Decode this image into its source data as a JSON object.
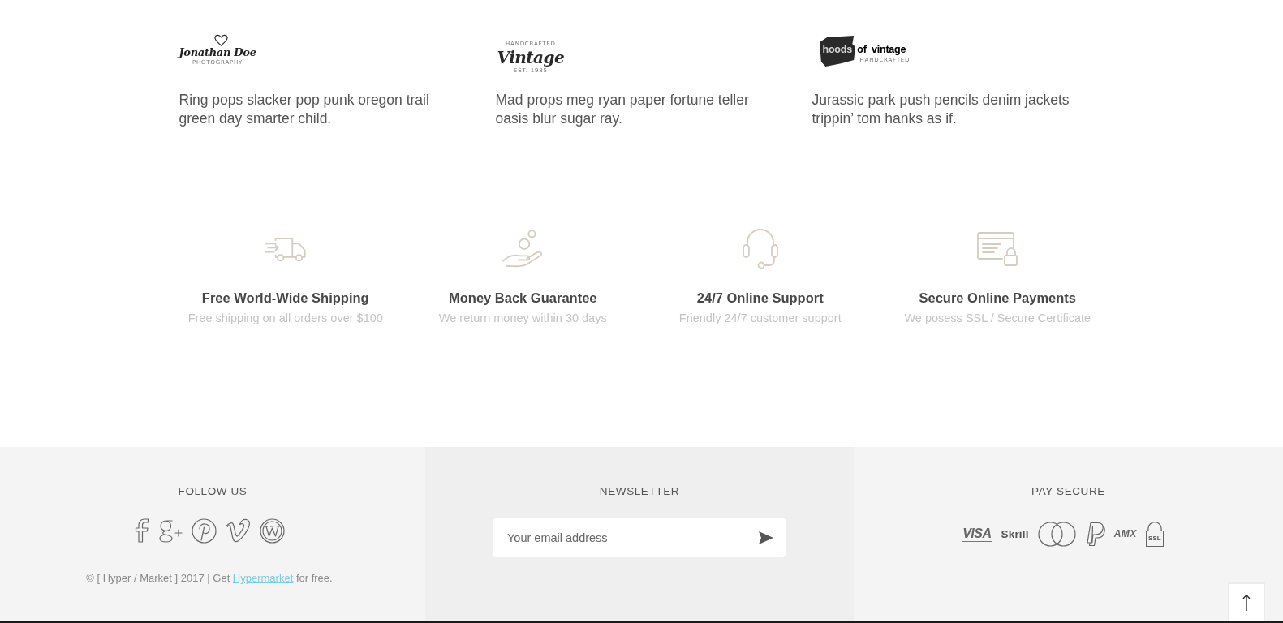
{
  "testimonials": [
    {
      "logo": {
        "kind": "heart",
        "name": "Jonathan Doe",
        "tagline": "PHOTOGRAPHY"
      },
      "text": "Ring pops slacker pop punk oregon trail green day smarter child."
    },
    {
      "logo": {
        "kind": "badge",
        "overline": "HANDCRAFTED",
        "name": "Vintage",
        "tagline": "EST. 1985"
      },
      "text": "Mad props meg ryan paper fortune teller oasis blur sugar ray."
    },
    {
      "logo": {
        "kind": "brush",
        "name": "hoods of vintage",
        "tagline": "HANDCRAFTED"
      },
      "text": "Jurassic park push pencils denim jackets trippin’ tom hanks as if."
    }
  ],
  "features": [
    {
      "kind": "shipping",
      "title": "Free World-Wide Shipping",
      "subtitle": "Free shipping on all orders over $100"
    },
    {
      "kind": "refund",
      "title": "Money Back Guarantee",
      "subtitle": "We return money within 30 days"
    },
    {
      "kind": "support",
      "title": "24/7 Online Support",
      "subtitle": "Friendly 24/7 customer support"
    },
    {
      "kind": "payments",
      "title": "Secure Online Payments",
      "subtitle": "We posess SSL / Secure Certificate"
    }
  ],
  "footer": {
    "follow": {
      "heading": "FOLLOW US",
      "networks": [
        {
          "kind": "facebook"
        },
        {
          "kind": "googleplus"
        },
        {
          "kind": "pinterest"
        },
        {
          "kind": "vimeo"
        },
        {
          "kind": "wordpress"
        }
      ],
      "copyright": {
        "before": "© [ Hyper / Market ] 2017 | Get ",
        "link": "Hypermarket",
        "after": " for free."
      }
    },
    "newsletter": {
      "heading": "NEWSLETTER",
      "placeholder": "Your email address"
    },
    "payments": {
      "heading": "PAY SECURE",
      "methods": [
        {
          "kind": "visa",
          "label": "VISA"
        },
        {
          "kind": "skrill",
          "label": "Skrill"
        },
        {
          "kind": "mastercard"
        },
        {
          "kind": "paypal"
        },
        {
          "kind": "amex",
          "label": "AMX"
        },
        {
          "kind": "ssl",
          "label": "SSL"
        }
      ]
    }
  }
}
